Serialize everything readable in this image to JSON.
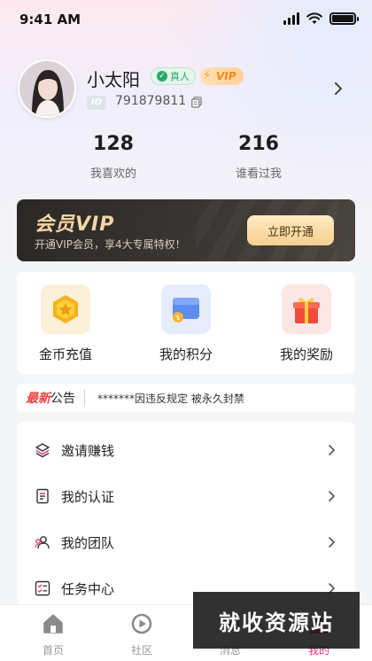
{
  "status_bar": {
    "time": "9:41 AM"
  },
  "profile": {
    "name": "小太阳",
    "real_badge": "真人",
    "vip_badge": "VIP",
    "id_label": "ID",
    "id_number": "791879811"
  },
  "stats": [
    {
      "value": "128",
      "label": "我喜欢的"
    },
    {
      "value": "216",
      "label": "谁看过我"
    }
  ],
  "vip_card": {
    "title": "会员VIP",
    "description": "开通VIP会员，享4大专属特权！",
    "button": "立即开通"
  },
  "quick_actions": [
    {
      "label": "金币充值",
      "icon": "gold-coin-icon"
    },
    {
      "label": "我的积分",
      "icon": "wallet-icon"
    },
    {
      "label": "我的奖励",
      "icon": "gift-icon"
    }
  ],
  "notice": {
    "new_label": "最新",
    "tag": "公告",
    "text": "*******因违反规定 被永久封禁"
  },
  "menu": [
    {
      "label": "邀请赚钱",
      "icon": "layers-icon"
    },
    {
      "label": "我的认证",
      "icon": "certificate-icon"
    },
    {
      "label": "我的团队",
      "icon": "team-icon"
    },
    {
      "label": "任务中心",
      "icon": "checklist-icon"
    }
  ],
  "tabbar": [
    {
      "label": "首页",
      "icon": "home-icon"
    },
    {
      "label": "社区",
      "icon": "community-icon"
    },
    {
      "label": "消息",
      "icon": "message-icon"
    },
    {
      "label": "我的",
      "icon": "profile-icon",
      "active": true
    }
  ],
  "watermark": "就收资源站",
  "colors": {
    "accent_pink": "#e8317a",
    "vip_gold": "#f6cf8f",
    "notice_red": "#f04444",
    "verified_green": "#2aa86a"
  }
}
